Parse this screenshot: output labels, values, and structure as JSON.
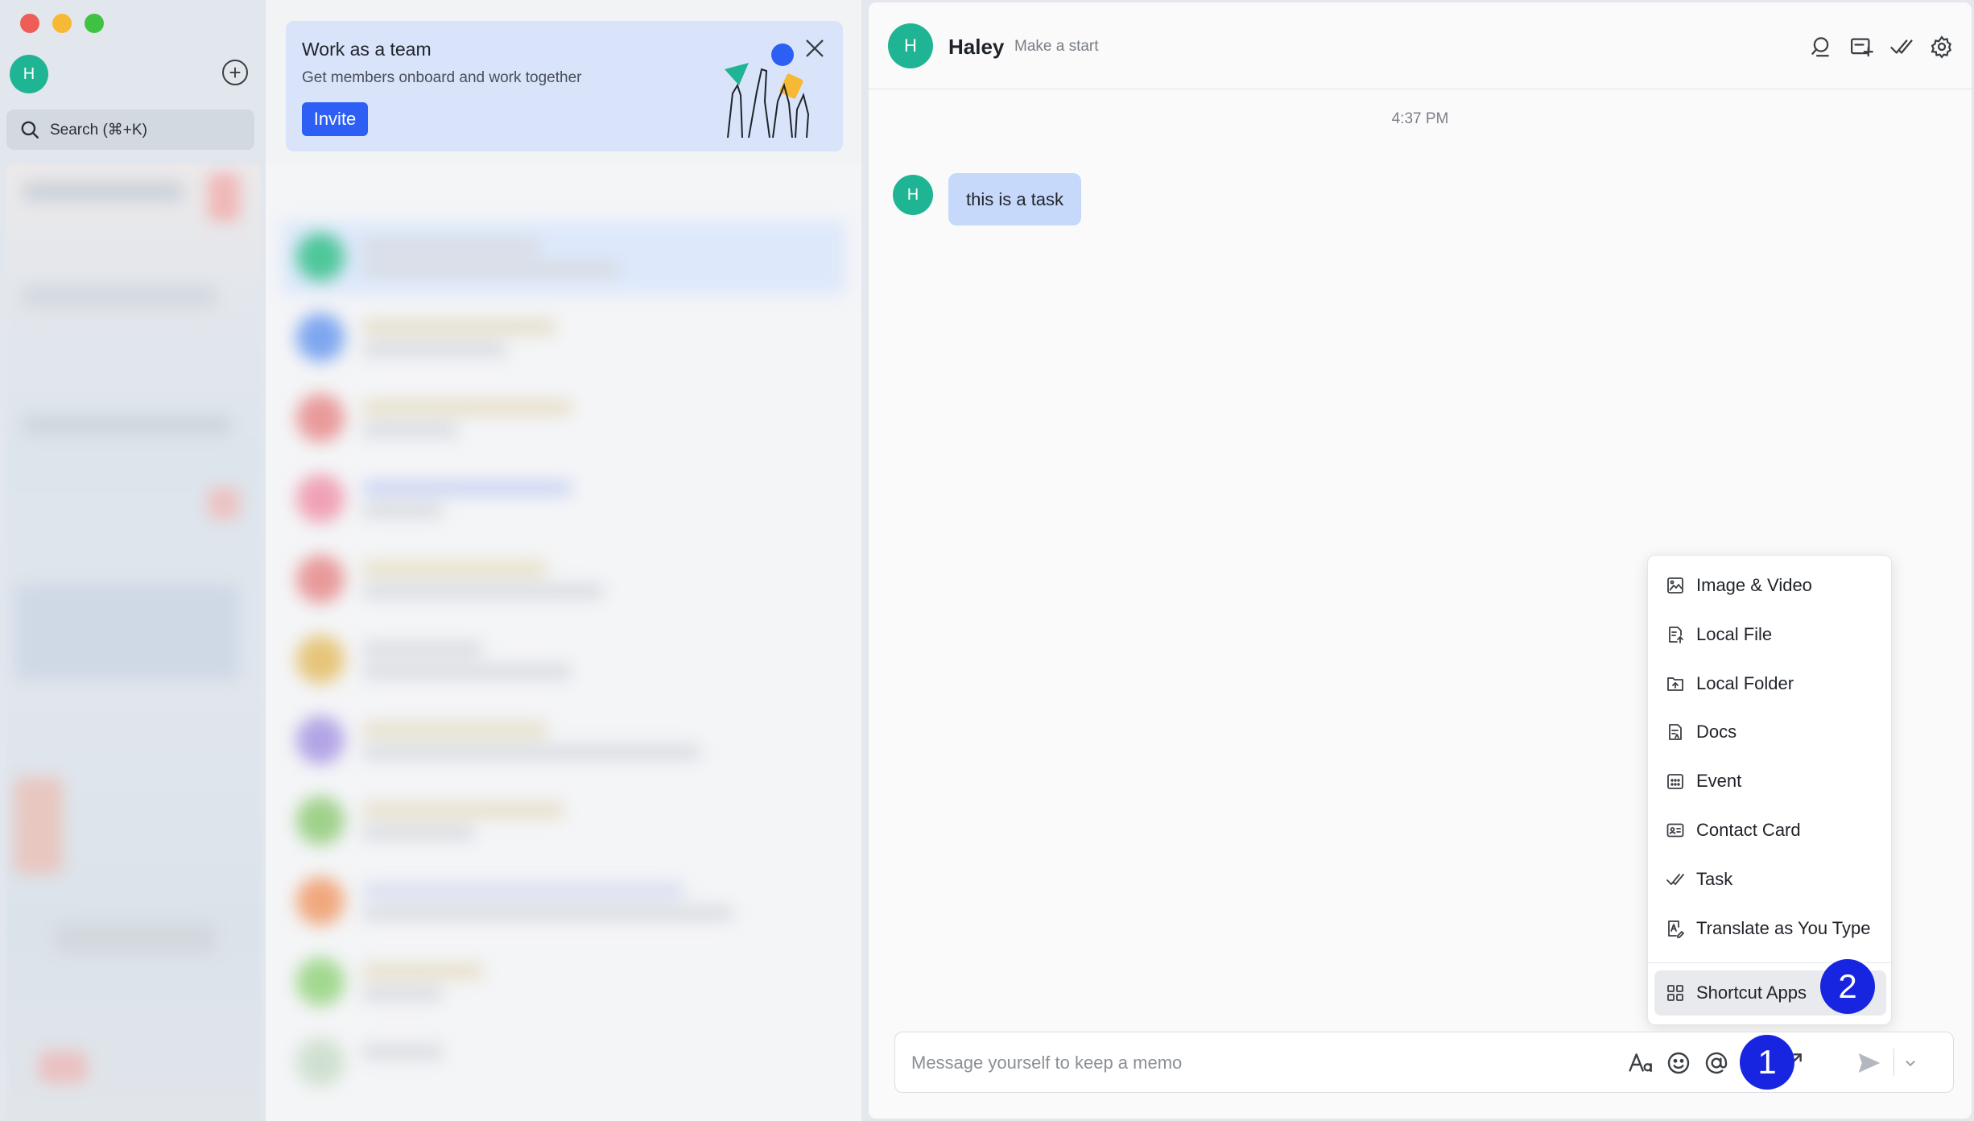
{
  "sidebar": {
    "avatar_initial": "H",
    "search_label": "Search (⌘+K)"
  },
  "team_card": {
    "title": "Work as a team",
    "subtitle": "Get members onboard and work together",
    "invite_label": "Invite"
  },
  "chat": {
    "avatar_initial": "H",
    "name": "Haley",
    "status": "Make a start",
    "header_icons": [
      "search-icon",
      "add-to-list-icon",
      "task-check-icon",
      "settings-gear-icon"
    ],
    "messages": [
      {
        "time": "4:37 PM",
        "sender_initial": "H",
        "text": "this is a task"
      }
    ],
    "input_placeholder": "Message yourself to keep a memo"
  },
  "plus_menu": {
    "items": [
      {
        "label": "Image & Video",
        "icon": "image-icon"
      },
      {
        "label": "Local File",
        "icon": "file-upload-icon"
      },
      {
        "label": "Local Folder",
        "icon": "folder-upload-icon"
      },
      {
        "label": "Docs",
        "icon": "docs-icon"
      },
      {
        "label": "Event",
        "icon": "calendar-icon"
      },
      {
        "label": "Contact Card",
        "icon": "contact-card-icon"
      },
      {
        "label": "Task",
        "icon": "task-check-icon"
      },
      {
        "label": "Translate as You Type",
        "icon": "translate-icon"
      },
      {
        "label": "Shortcut Apps",
        "icon": "grid-apps-icon"
      }
    ],
    "active_item": "Shortcut Apps"
  },
  "input_icons": [
    "text-format-icon",
    "emoji-icon",
    "mention-at-icon",
    "plus-circle-icon",
    "expand-icon",
    "send-icon",
    "chevron-down-icon"
  ],
  "steps": [
    "1",
    "2"
  ],
  "colors": {
    "accent": "#2d5ff5",
    "avatar": "#1fb594",
    "bubble": "#c6d9fb",
    "team_card": "#d9e4fb",
    "step_badge": "#1725e0"
  }
}
